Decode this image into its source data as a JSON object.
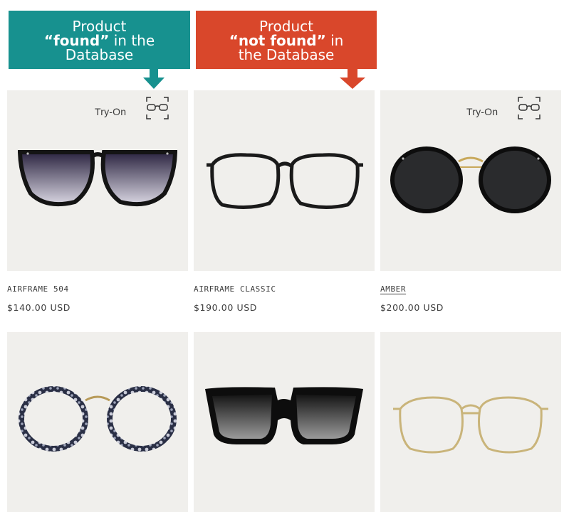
{
  "callouts": {
    "found": {
      "line1": "Product",
      "line2_bold": "“found”",
      "line2_rest": " in the",
      "line3": "Database",
      "color": "#17918f"
    },
    "not_found": {
      "line1": "Product",
      "line2_bold": "“not found”",
      "line2_rest": " in",
      "line3": "the Database",
      "color": "#d9472b"
    }
  },
  "tryon_label": "Try-On",
  "products": [
    {
      "name": "AIRFRAME 504",
      "price": "$140.00 USD",
      "has_tryon": true,
      "icon": "gradient-sunglasses-image"
    },
    {
      "name": "AIRFRAME CLASSIC",
      "price": "$190.00 USD",
      "has_tryon": false,
      "icon": "clear-square-glasses-image"
    },
    {
      "name": "AMBER",
      "price": "$200.00 USD",
      "has_tryon": true,
      "icon": "dark-round-sunglasses-image"
    },
    {
      "name": "",
      "price": "",
      "has_tryon": false,
      "icon": "tortoise-round-glasses-image"
    },
    {
      "name": "",
      "price": "",
      "has_tryon": false,
      "icon": "oversized-square-sunglasses-image"
    },
    {
      "name": "",
      "price": "",
      "has_tryon": false,
      "icon": "gold-wire-glasses-image"
    }
  ],
  "colors": {
    "card_bg": "#f0efec",
    "text": "#3d3d3d"
  }
}
